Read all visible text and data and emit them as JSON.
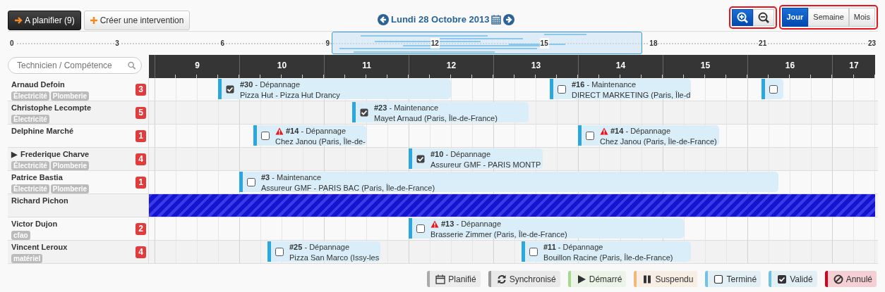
{
  "toolbar": {
    "plan_button": "A planifier (9)",
    "create_button": "Créer une intervention",
    "date": "Lundi 28 Octobre 2013",
    "zoom": {
      "highlighted": true,
      "buttons": [
        {
          "kind": "in",
          "selected": true
        },
        {
          "kind": "out",
          "selected": false
        }
      ]
    },
    "views": {
      "highlighted": true,
      "items": [
        {
          "label": "Jour",
          "selected": true
        },
        {
          "label": "Semaine",
          "selected": false
        },
        {
          "label": "Mois",
          "selected": false
        }
      ]
    }
  },
  "overview": {
    "ticks": [
      "0",
      "3",
      "6",
      "9",
      "12",
      "15",
      "18",
      "21",
      "23"
    ]
  },
  "search": {
    "placeholder": "Technicien / Compétence"
  },
  "hours": [
    "9",
    "10",
    "11",
    "12",
    "13",
    "14",
    "15",
    "16",
    "17"
  ],
  "rows": [
    {
      "name": "Arnaud Defoin",
      "skills": [
        "Électricité",
        "Plomberie"
      ],
      "count": "3",
      "events": [
        {
          "label": "**#30** - Dépannage",
          "client": "Pizza Hut - Pizza Hut Drancy",
          "checked": true,
          "warning": false
        },
        {
          "label": "**#16** - Maintenance",
          "client": "DIRECT MARKETING (Paris, Île-d",
          "checked": false,
          "warning": false
        },
        {
          "checked": false
        }
      ]
    },
    {
      "name": "Christophe Lecompte",
      "skills": [
        "Électricité"
      ],
      "count": "5",
      "events": [
        {
          "label": "**#23** - Maintenance",
          "client": "Mayet Arnaud (Paris, Île-de-France)",
          "checked": true,
          "warning": false
        }
      ]
    },
    {
      "name": "Delphine Marché",
      "count": "1",
      "events": [
        {
          "label": "**#14** - Dépannage",
          "client": "Chez Janou (Paris, Île-de-",
          "checked": false,
          "warning": true
        },
        {
          "label": "**#14** - Dépannage",
          "client": "Chez Janou (Paris, Île-de-France)",
          "checked": false,
          "warning": true
        }
      ]
    },
    {
      "name": "Frederique Charve",
      "expander": "▶",
      "skills": [
        "Électricité",
        "Plomberie"
      ],
      "count": "4",
      "events": [
        {
          "label": "**#10** - Dépannage",
          "client": "Assureur GMF - PARIS MONTP",
          "checked": true,
          "warning": false
        }
      ]
    },
    {
      "name": "Patrice Bastia",
      "skills": [
        "Électricité",
        "Plomberie"
      ],
      "count": "1",
      "events": [
        {
          "label": "**#3** - Maintenance",
          "client": "Assureur GMF - PARIS BAC (Paris, Île-de-France)",
          "checked": false,
          "warning": false
        }
      ]
    },
    {
      "name": "Richard Pichon",
      "unavailable": true
    },
    {
      "name": "Victor Dujon",
      "skills": [
        "cfao"
      ],
      "count": "2",
      "events": [
        {
          "label": "**#13** - Dépannage",
          "client": "Brasserie Zimmer (Paris, Île-de-France)",
          "checked": false,
          "warning": true
        }
      ]
    },
    {
      "name": "Vincent Leroux",
      "skills": [
        "matériel"
      ],
      "count": "4",
      "events": [
        {
          "label": "**#25** - Dépannage",
          "client": "Pizza San Marco (Issy-les",
          "checked": false,
          "warning": false
        },
        {
          "label": "**#11** - Dépannage",
          "client": "Bouillon Racine (Paris, Île-de-France)",
          "checked": false,
          "warning": false
        }
      ]
    }
  ],
  "legend": [
    {
      "kind": "planned",
      "label": "Planifié",
      "color": "#aaaaaa"
    },
    {
      "kind": "synced",
      "label": "Synchronisé",
      "color": "#999999"
    },
    {
      "kind": "started",
      "label": "Démarré",
      "color": "#a6d98c"
    },
    {
      "kind": "paused",
      "label": "Suspendu",
      "color": "#f0b97a"
    },
    {
      "kind": "done",
      "label": "Terminé",
      "color": "#6cc3e6"
    },
    {
      "kind": "validated",
      "label": "Validé",
      "color": "#6cc3e6"
    },
    {
      "kind": "cancelled",
      "label": "Annulé",
      "color": "#d9001b"
    }
  ]
}
